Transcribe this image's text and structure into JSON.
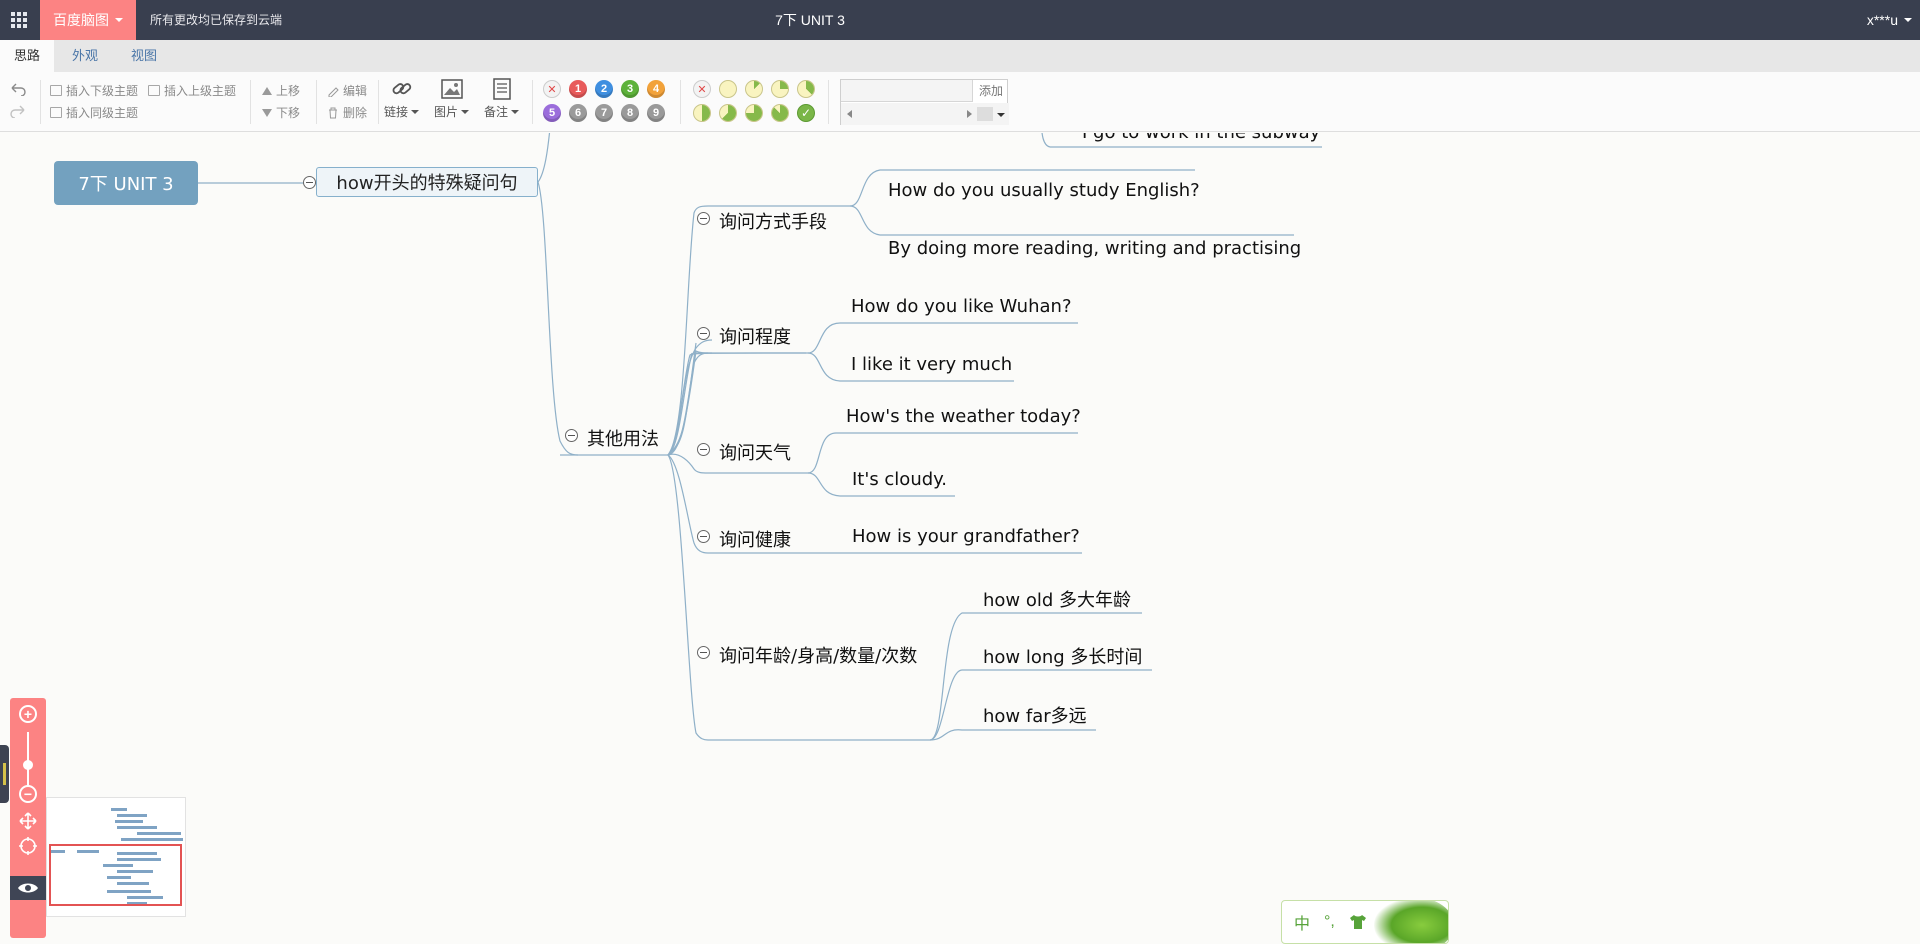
{
  "topbar": {
    "brand_label": "百度脑图",
    "save_status": "所有更改均已保存到云端",
    "title": "7下 UNIT 3",
    "user_label": "x***u"
  },
  "tabs": [
    {
      "label": "思路",
      "active": true
    },
    {
      "label": "外观",
      "active": false
    },
    {
      "label": "视图",
      "active": false
    }
  ],
  "toolbar": {
    "insert_child": "插入下级主题",
    "insert_parent": "插入上级主题",
    "insert_sibling": "插入同级主题",
    "move_up": "上移",
    "move_down": "下移",
    "edit": "编辑",
    "delete": "删除",
    "link": "链接",
    "image": "图片",
    "note": "备注",
    "priorities": [
      "1",
      "2",
      "3",
      "4",
      "5",
      "6",
      "7",
      "8",
      "9"
    ],
    "resource_add": "添加"
  },
  "mindmap": {
    "root": "7下 UNIT 3",
    "main_topic": "how开头的特殊疑问句",
    "partial_top": "I go to work in the subway",
    "branch": "其他用法",
    "subtopics": [
      {
        "label": "询问方式手段",
        "children": [
          "How do you usually study English?",
          "By doing more reading, writing and practising"
        ]
      },
      {
        "label": "询问程度",
        "children": [
          "How do you like Wuhan?",
          "I like it very much"
        ]
      },
      {
        "label": "询问天气",
        "children": [
          "How's the weather today?",
          "It's cloudy."
        ]
      },
      {
        "label": "询问健康",
        "children": [
          "How is your grandfather?"
        ]
      },
      {
        "label": "询问年龄/身高/数量/次数",
        "children": [
          "how old 多大年龄",
          "how long 多长时间",
          "how far多远"
        ]
      }
    ]
  },
  "ime": {
    "lang": "中",
    "punct": "°,"
  },
  "colors": {
    "topbar": "#393f4f",
    "accent": "#fc8383",
    "root_node": "#73a1bf",
    "edge": "#8fb0c8"
  }
}
